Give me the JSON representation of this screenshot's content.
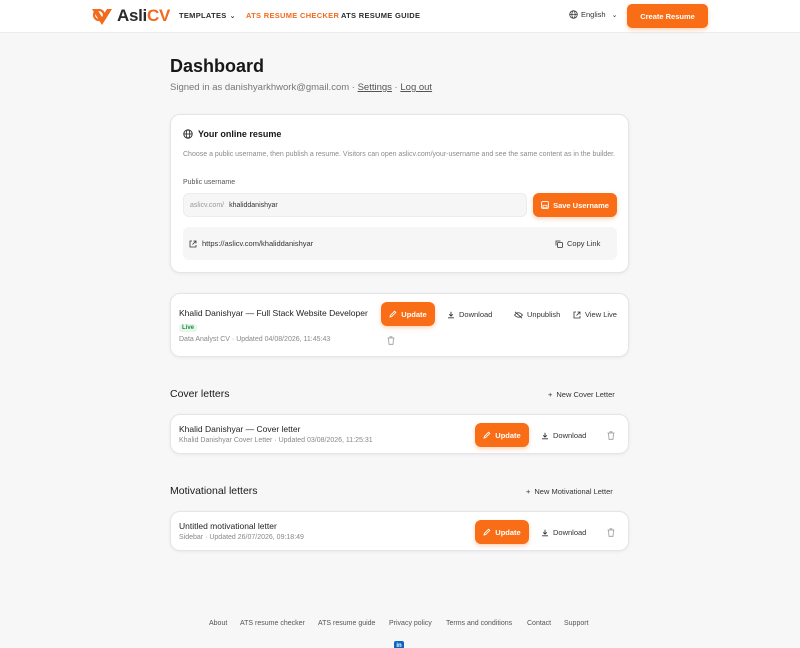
{
  "brand": {
    "logo_a": "Asli",
    "logo_b": "CV",
    "accent": "#f96d16"
  },
  "nav": {
    "templates": "TEMPLATES",
    "ats_checker": "ATS RESUME CHECKER",
    "ats_guide": "ATS RESUME GUIDE",
    "language": "English",
    "create_resume": "Create Resume"
  },
  "dashboard": {
    "title": "Dashboard",
    "signed_in_prefix": "Signed in as danishyarkhwork@gmail.com · ",
    "settings": "Settings",
    "sep": " · ",
    "logout": "Log out"
  },
  "online_resume": {
    "heading": "Your online resume",
    "description": "Choose a public username, then publish a resume. Visitors can open aslicv.com/your-username and see the same content as in the builder.",
    "username_label": "Public username",
    "prefix": "aslicv.com/",
    "username_value": "khaliddanishyar",
    "save_button": "Save Username",
    "public_url": "https://aslicv.com/khaliddanishyar",
    "copy_link": "Copy Link"
  },
  "resume": {
    "title": "Khalid Danishyar — Full Stack Website Developer",
    "status": "Live",
    "meta": "Data Analyst CV · Updated 04/08/2026, 11:45:43",
    "update": "Update",
    "download": "Download",
    "unpublish": "Unpublish",
    "view_live": "View Live"
  },
  "cover_letters": {
    "section_title": "Cover letters",
    "new_button": "New Cover Letter",
    "item_title": "Khalid Danishyar — Cover letter",
    "item_meta": "Khalid Danishyar Cover Letter · Updated 03/08/2026, 11:25:31",
    "update": "Update",
    "download": "Download"
  },
  "motivational_letters": {
    "section_title": "Motivational letters",
    "new_button": "New Motivational Letter",
    "item_title": "Untitled motivational letter",
    "item_meta": "Sidebar · Updated 26/07/2026, 09:18:49",
    "update": "Update",
    "download": "Download"
  },
  "footer": {
    "about": "About",
    "ats_checker": "ATS resume checker",
    "ats_guide": "ATS resume guide",
    "privacy": "Privacy policy",
    "terms": "Terms and conditions",
    "contact": "Contact",
    "support": "Support",
    "linkedin": "in"
  }
}
